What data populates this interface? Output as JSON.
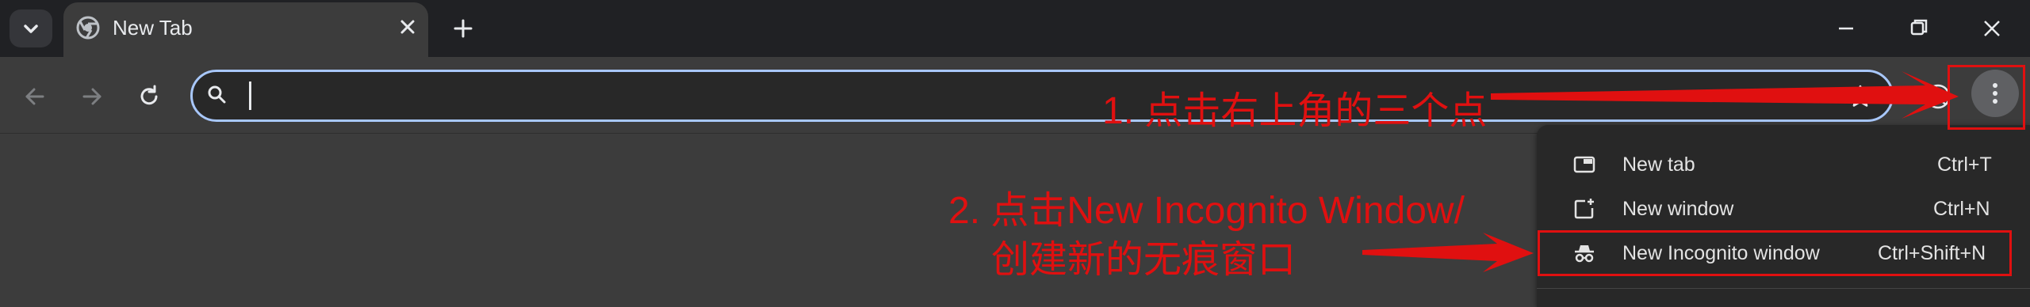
{
  "tab": {
    "title": "New Tab"
  },
  "omnibox": {
    "value": ""
  },
  "menu": {
    "items": [
      {
        "label": "New tab",
        "shortcut": "Ctrl+T",
        "icon": "new-tab-icon"
      },
      {
        "label": "New window",
        "shortcut": "Ctrl+N",
        "icon": "new-window-icon"
      },
      {
        "label": "New Incognito window",
        "shortcut": "Ctrl+Shift+N",
        "icon": "incognito-icon"
      }
    ]
  },
  "annotations": {
    "step1": "1. 点击右上角的三个点",
    "step2_line1": "2. 点击New Incognito Window/",
    "step2_line2": "创建新的无痕窗口"
  },
  "colors": {
    "tabstrip": "#202124",
    "toolbar": "#3c3c3c",
    "omnibox_border": "#a8c7fa",
    "menu_bg": "#282828",
    "annotation_red": "#e01010"
  }
}
